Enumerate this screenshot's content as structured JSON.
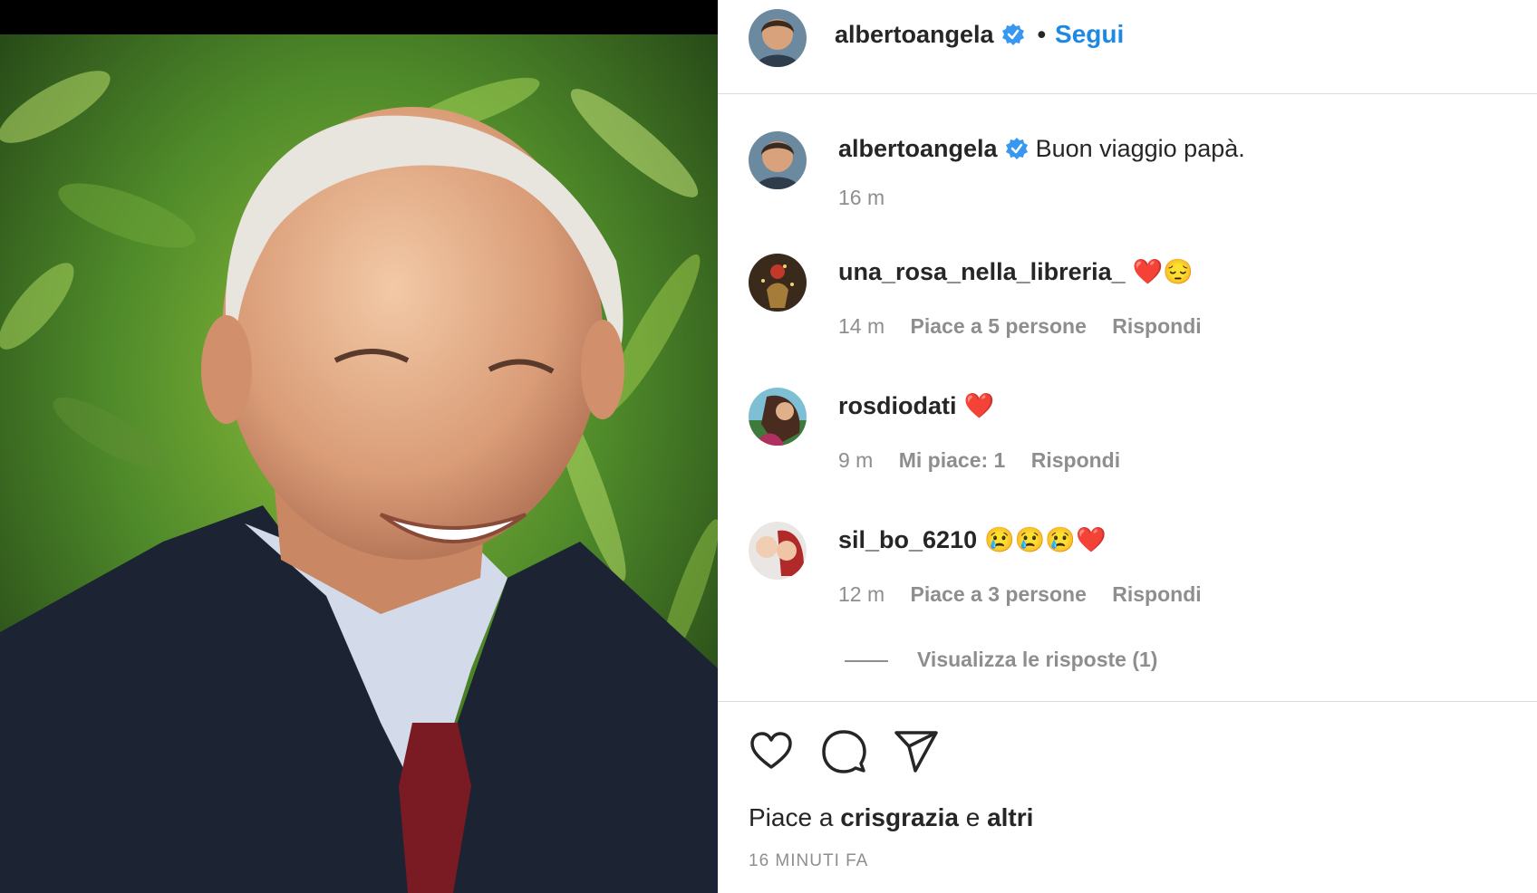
{
  "header": {
    "username": "albertoangela",
    "separator": "•",
    "follow_label": "Segui"
  },
  "caption": {
    "username": "albertoangela",
    "text": "Buon viaggio papà.",
    "time": "16 m"
  },
  "comments": [
    {
      "username": "una_rosa_nella_libreria_",
      "text": "❤️😔",
      "time": "14 m",
      "likes": "Piace a 5 persone",
      "reply": "Rispondi"
    },
    {
      "username": "rosdiodati",
      "text": "❤️",
      "time": "9 m",
      "likes": "Mi piace: 1",
      "reply": "Rispondi"
    },
    {
      "username": "sil_bo_6210",
      "text": "😢😢😢❤️",
      "time": "12 m",
      "likes": "Piace a 3 persone",
      "reply": "Rispondi"
    }
  ],
  "view_replies": "Visualizza le risposte (1)",
  "actions": {
    "like_icon": "heart-icon",
    "comment_icon": "comment-icon",
    "share_icon": "send-icon"
  },
  "likes_line": {
    "prefix": "Piace a",
    "user": "crisgrazia",
    "conj": "e",
    "others": "altri"
  },
  "timestamp": "16 MINUTI FA",
  "colors": {
    "follow": "#1e88e5",
    "verified": "#3897f0",
    "meta": "#8e8e8e",
    "text": "#262626"
  }
}
